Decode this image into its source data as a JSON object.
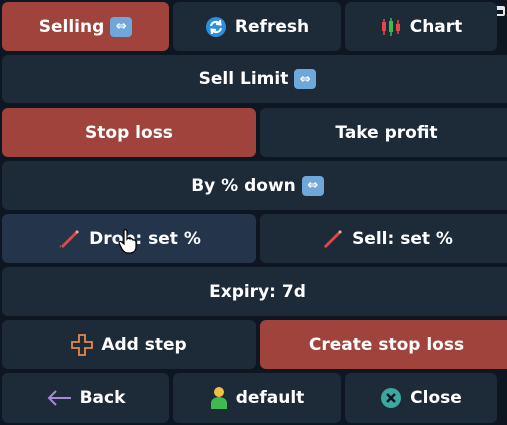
{
  "row1": {
    "selling": "Selling",
    "refresh": "Refresh",
    "chart": "Chart"
  },
  "row2": {
    "sell_limit": "Sell Limit"
  },
  "row3": {
    "stop_loss": "Stop loss",
    "take_profit": "Take profit"
  },
  "row4": {
    "by_percent": "By % down"
  },
  "row5": {
    "drop": "Drop: set %",
    "sell": "Sell: set %"
  },
  "row6": {
    "expiry": "Expiry: 7d"
  },
  "row7": {
    "add_step": "Add step",
    "create": "Create stop loss"
  },
  "row8": {
    "back": "Back",
    "profile": "default",
    "close": "Close"
  },
  "icons": {
    "swap": "left-right-arrow-icon",
    "refresh": "refresh-icon",
    "chart": "candlestick-chart-icon",
    "pencil": "pencil-icon",
    "plus": "plus-icon",
    "back": "left-arrow-icon",
    "user": "user-icon",
    "close": "close-circle-icon"
  },
  "colors": {
    "background": "#0e1621",
    "button": "#1d2a38",
    "active": "#a0433c",
    "swap_badge": "#6fa8d8"
  }
}
